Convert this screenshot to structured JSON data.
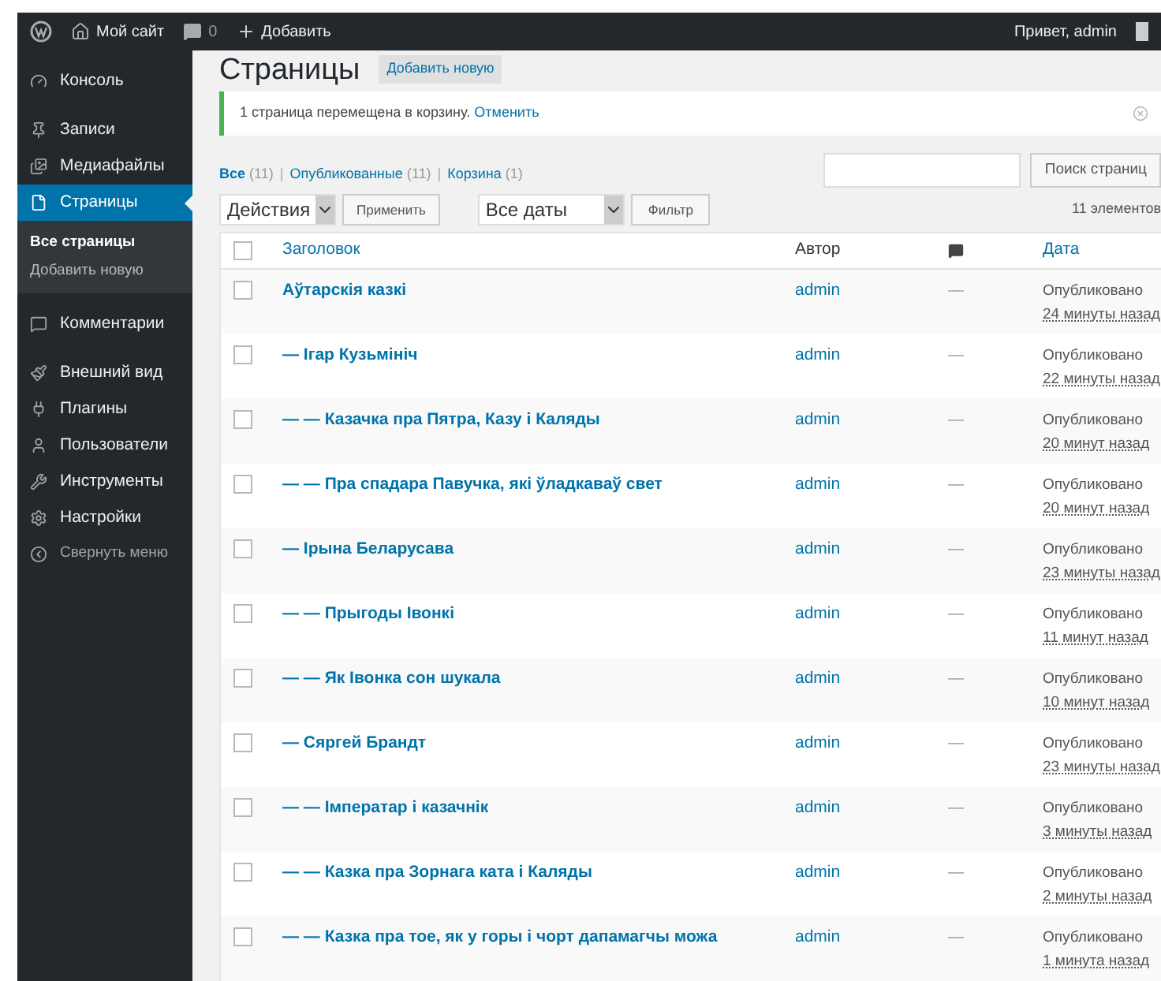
{
  "admin_bar": {
    "site": "Мой сайт",
    "comments": "0",
    "add_new": "Добавить",
    "greeting": "Привет, admin"
  },
  "sidebar": {
    "items": [
      {
        "label": "Консоль",
        "selected": false
      },
      {
        "label": "Записи",
        "selected": false
      },
      {
        "label": "Медиафайлы",
        "selected": false
      },
      {
        "label": "Страницы",
        "selected": true,
        "children": [
          {
            "label": "Все страницы",
            "selected": true
          },
          {
            "label": "Добавить новую",
            "selected": false
          }
        ]
      },
      {
        "label": "Комментарии",
        "selected": false
      },
      {
        "label": "Внешний вид",
        "selected": false
      },
      {
        "label": "Плагины",
        "selected": false
      },
      {
        "label": "Пользователи",
        "selected": false
      },
      {
        "label": "Инструменты",
        "selected": false
      },
      {
        "label": "Настройки",
        "selected": false
      }
    ],
    "collapse": "Свернуть меню"
  },
  "page": {
    "title": "Страницы",
    "add_new": "Добавить новую"
  },
  "notice": {
    "text": "1 страница перемещена в корзину.",
    "undo": "Отменить"
  },
  "filters": [
    {
      "label": "Все",
      "count": "(11)",
      "selected": true
    },
    {
      "separator": "|",
      "label": "Опубликованные",
      "count": "(11)",
      "selected": false
    },
    {
      "separator": "|",
      "label": "Корзина",
      "count": "(1)",
      "selected": false
    }
  ],
  "search": {
    "button": "Поиск страниц"
  },
  "bulk": {
    "action": "Действия",
    "apply": "Применить",
    "dates": "Все даты",
    "filter": "Фильтр",
    "count": "11 элементов"
  },
  "table": {
    "columns": {
      "title": "Заголовок",
      "author": "Автор",
      "date": "Дата"
    },
    "header_checked": false,
    "rows": [
      {
        "title": "Аўтарскія казкі",
        "author": "admin",
        "comments": "—",
        "status": "Опубликовано",
        "time": "24 минуты назад",
        "checked": false
      },
      {
        "title": "— Ігар Кузьмініч",
        "author": "admin",
        "comments": "—",
        "status": "Опубликовано",
        "time": "22 минуты назад",
        "checked": false
      },
      {
        "title": "— — Казачка пра Пятра, Казу і Каляды",
        "author": "admin",
        "comments": "—",
        "status": "Опубликовано",
        "time": "20 минут назад",
        "checked": false
      },
      {
        "title": "— — Пра спадара Павучка, які ўладкаваў свет",
        "author": "admin",
        "comments": "—",
        "status": "Опубликовано",
        "time": "20 минут назад",
        "checked": false
      },
      {
        "title": "— Ірына Беларусава",
        "author": "admin",
        "comments": "—",
        "status": "Опубликовано",
        "time": "23 минуты назад",
        "checked": false
      },
      {
        "title": "— — Прыгоды Івонкі",
        "author": "admin",
        "comments": "—",
        "status": "Опубликовано",
        "time": "11 минут назад",
        "checked": false
      },
      {
        "title": "— — Як Івонка сон шукала",
        "author": "admin",
        "comments": "—",
        "status": "Опубликовано",
        "time": "10 минут назад",
        "checked": false
      },
      {
        "title": "— Сяргей Брандт",
        "author": "admin",
        "comments": "—",
        "status": "Опубликовано",
        "time": "23 минуты назад",
        "checked": false
      },
      {
        "title": "— — Імператар і казачнік",
        "author": "admin",
        "comments": "—",
        "status": "Опубликовано",
        "time": "3 минуты назад",
        "checked": false
      },
      {
        "title": "— — Казка пра Зорнага ката і Каляды",
        "author": "admin",
        "comments": "—",
        "status": "Опубликовано",
        "time": "2 минуты назад",
        "checked": false
      },
      {
        "title": "— — Казка пра тое, як у горы і чорт дапамагчы можа",
        "author": "admin",
        "comments": "—",
        "status": "Опубликовано",
        "time": "1 минута назад",
        "checked": false
      }
    ]
  }
}
